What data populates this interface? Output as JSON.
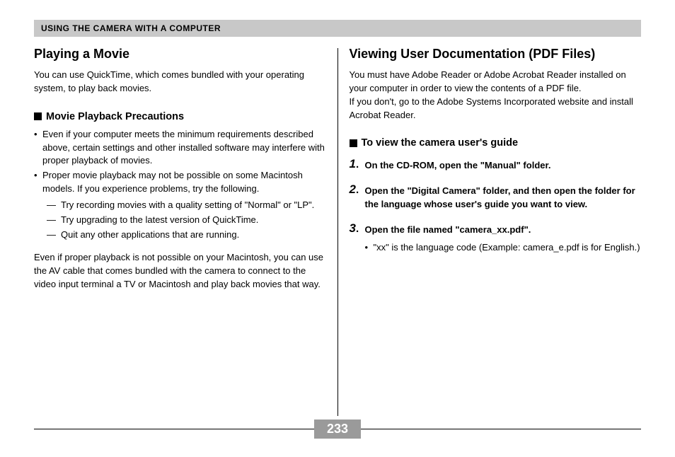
{
  "header": "USING THE CAMERA WITH A COMPUTER",
  "left": {
    "title": "Playing a Movie",
    "intro": "You can use QuickTime, which comes bundled with your operating system, to play back movies.",
    "subhead": "Movie Playback Precautions",
    "bullets": [
      "Even if your computer meets the minimum requirements described above, certain settings and other installed software may interfere with proper playback of movies.",
      "Proper movie playback may not be possible on some Macintosh models. If you experience problems, try the following."
    ],
    "dashes": [
      "Try recording movies with a quality setting of \"Normal\" or \"LP\".",
      "Try upgrading to the latest version of QuickTime.",
      "Quit any other applications that are running."
    ],
    "para_after": "Even if proper playback is not possible on your Macintosh, you can use the AV cable that comes bundled with the camera to connect to the video input terminal a TV or Macintosh and play back movies that way."
  },
  "right": {
    "title": "Viewing User Documentation (PDF Files)",
    "intro1": "You must have Adobe Reader or Adobe Acrobat Reader installed on your computer in order to view the contents of a PDF file.",
    "intro2": "If you don't, go to the Adobe Systems Incorporated website and install Acrobat Reader.",
    "subhead": "To view the camera user's guide",
    "steps": [
      {
        "num": "1",
        "text": "On the CD-ROM, open the \"Manual\" folder."
      },
      {
        "num": "2",
        "text": "Open the \"Digital Camera\" folder, and then open the folder for the language whose user's guide you want to view."
      },
      {
        "num": "3",
        "text": "Open the file named \"camera_xx.pdf\".",
        "note": "\"xx\" is the language code (Example: camera_e.pdf is for English.)"
      }
    ]
  },
  "page_number": "233"
}
